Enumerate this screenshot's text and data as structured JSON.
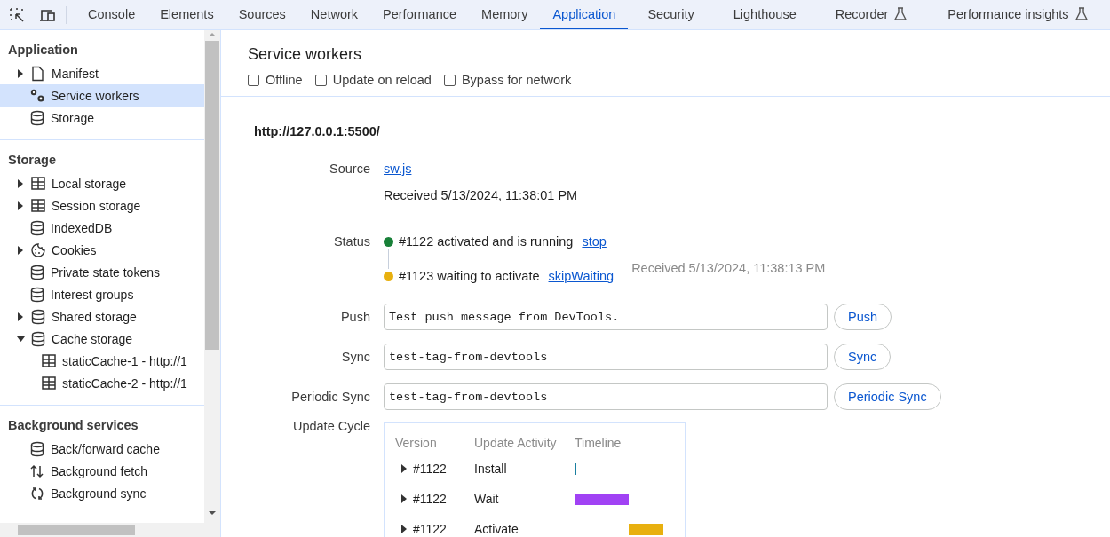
{
  "toolbar": {
    "tabs": [
      {
        "label": "Console",
        "selected": false,
        "experimental": false
      },
      {
        "label": "Elements",
        "selected": false,
        "experimental": false
      },
      {
        "label": "Sources",
        "selected": false,
        "experimental": false
      },
      {
        "label": "Network",
        "selected": false,
        "experimental": false
      },
      {
        "label": "Performance",
        "selected": false,
        "experimental": false
      },
      {
        "label": "Memory",
        "selected": false,
        "experimental": false
      },
      {
        "label": "Application",
        "selected": true,
        "experimental": false
      },
      {
        "label": "Security",
        "selected": false,
        "experimental": false
      },
      {
        "label": "Lighthouse",
        "selected": false,
        "experimental": false
      },
      {
        "label": "Recorder",
        "selected": false,
        "experimental": true
      },
      {
        "label": "Performance insights",
        "selected": false,
        "experimental": true
      }
    ]
  },
  "sidebar": {
    "sections": [
      {
        "title": "Application",
        "items": [
          {
            "label": "Manifest",
            "kind": "document",
            "expanded": false,
            "selected": false
          },
          {
            "label": "Service workers",
            "kind": "gears",
            "selected": true
          },
          {
            "label": "Storage",
            "kind": "database",
            "selected": false
          }
        ]
      },
      {
        "title": "Storage",
        "items": [
          {
            "label": "Local storage",
            "kind": "table",
            "expanded": false,
            "selected": false
          },
          {
            "label": "Session storage",
            "kind": "table",
            "expanded": false,
            "selected": false
          },
          {
            "label": "IndexedDB",
            "kind": "database",
            "selected": false
          },
          {
            "label": "Cookies",
            "kind": "cookie",
            "expanded": false,
            "selected": false
          },
          {
            "label": "Private state tokens",
            "kind": "database",
            "selected": false
          },
          {
            "label": "Interest groups",
            "kind": "database",
            "selected": false
          },
          {
            "label": "Shared storage",
            "kind": "database",
            "expanded": false,
            "selected": false
          },
          {
            "label": "Cache storage",
            "kind": "database",
            "expanded": true,
            "selected": false,
            "children": [
              {
                "label": "staticCache-1 - http://1",
                "kind": "table",
                "selected": false
              },
              {
                "label": "staticCache-2 - http://1",
                "kind": "table",
                "selected": false
              }
            ]
          }
        ]
      },
      {
        "title": "Background services",
        "items": [
          {
            "label": "Back/forward cache",
            "kind": "database",
            "selected": false
          },
          {
            "label": "Background fetch",
            "kind": "updown",
            "selected": false
          },
          {
            "label": "Background sync",
            "kind": "sync",
            "selected": false
          }
        ]
      }
    ]
  },
  "panel": {
    "title": "Service workers",
    "options": [
      {
        "label": "Offline",
        "checked": false
      },
      {
        "label": "Update on reload",
        "checked": false
      },
      {
        "label": "Bypass for network",
        "checked": false
      }
    ],
    "origin": "http://127.0.0.1:5500/",
    "source": {
      "label": "Source",
      "link": "sw.js",
      "received": "Received 5/13/2024, 11:38:01 PM"
    },
    "status": {
      "label": "Status",
      "entries": [
        {
          "text": "#1122 activated and is running",
          "action": "stop",
          "color": "#188038"
        },
        {
          "text": "#1123 waiting to activate",
          "action": "skipWaiting",
          "color": "#e8b00f",
          "received": "Received 5/13/2024, 11:38:13 PM"
        }
      ]
    },
    "forms": [
      {
        "label": "Push",
        "value": "Test push message from DevTools.",
        "button": "Push"
      },
      {
        "label": "Sync",
        "value": "test-tag-from-devtools",
        "button": "Sync"
      },
      {
        "label": "Periodic Sync",
        "value": "test-tag-from-devtools",
        "button": "Periodic Sync"
      }
    ],
    "update_cycle": {
      "label": "Update Cycle",
      "columns": [
        "Version",
        "Update Activity",
        "Timeline"
      ],
      "rows": [
        {
          "version": "#1122",
          "activity": "Install",
          "kind": "install",
          "color": "#1a7fa0"
        },
        {
          "version": "#1122",
          "activity": "Wait",
          "kind": "wait",
          "color": "#a142f4"
        },
        {
          "version": "#1122",
          "activity": "Activate",
          "kind": "activate",
          "color": "#e8b00f"
        }
      ]
    }
  }
}
